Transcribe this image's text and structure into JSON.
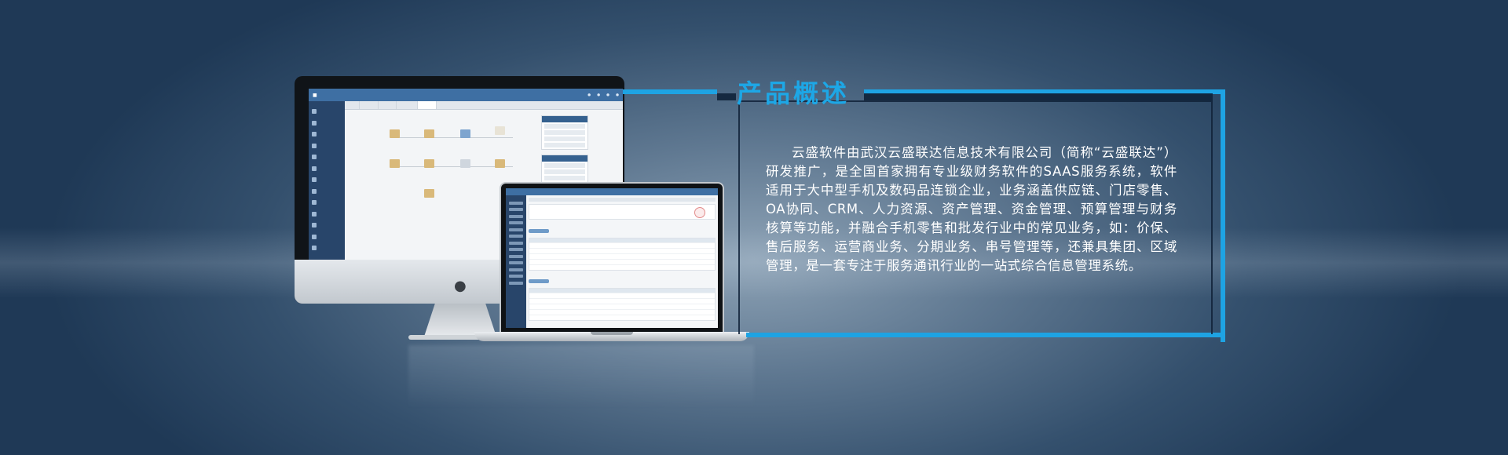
{
  "section": {
    "title": "产品概述",
    "description": "云盛软件由武汉云盛联达信息技术有限公司（简称“云盛联达”）研发推广，是全国首家拥有专业级财务软件的SAAS服务系统，软件适用于大中型手机及数码品连锁企业，业务涵盖供应链、门店零售、OA协同、CRM、人力资源、资产管理、资金管理、预算管理与财务核算等功能，并融合手机零售和批发行业中的常见业务，如：价保、售后服务、运营商业务、分期业务、串号管理等，还兼具集团、区域管理，是一套专注于服务通讯行业的一站式综合信息管理系统。"
  },
  "colors": {
    "accent": "#1ea3e3",
    "background": "#2a4566"
  }
}
